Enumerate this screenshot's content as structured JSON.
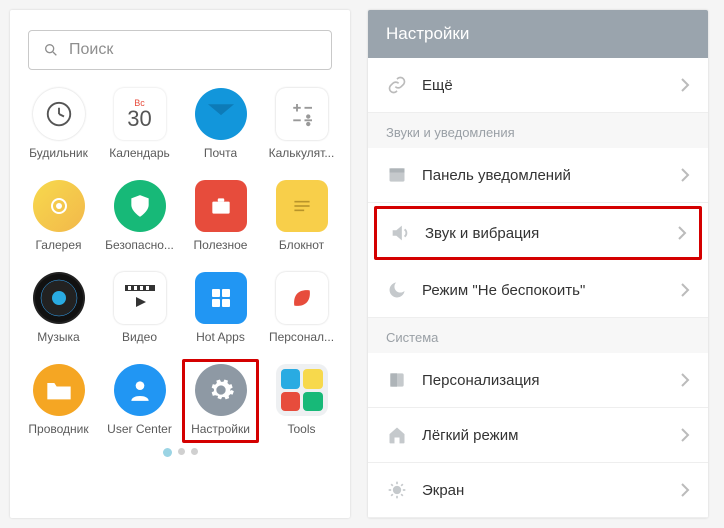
{
  "left": {
    "search_placeholder": "Поиск",
    "apps": [
      {
        "id": "alarm",
        "label": "Будильник"
      },
      {
        "id": "calendar",
        "label": "Календарь",
        "dow": "Вс",
        "day": "30"
      },
      {
        "id": "mail",
        "label": "Почта"
      },
      {
        "id": "calc",
        "label": "Калькулят..."
      },
      {
        "id": "gallery",
        "label": "Галерея"
      },
      {
        "id": "security",
        "label": "Безопасно..."
      },
      {
        "id": "useful",
        "label": "Полезное"
      },
      {
        "id": "notes",
        "label": "Блокнот"
      },
      {
        "id": "music",
        "label": "Музыка"
      },
      {
        "id": "video",
        "label": "Видео"
      },
      {
        "id": "hotapps",
        "label": "Hot Apps"
      },
      {
        "id": "personal",
        "label": "Персонал..."
      },
      {
        "id": "explorer",
        "label": "Проводник"
      },
      {
        "id": "usercenter",
        "label": "User Center"
      },
      {
        "id": "settings",
        "label": "Настройки",
        "highlight": true
      },
      {
        "id": "tools",
        "label": "Tools"
      }
    ]
  },
  "right": {
    "title": "Настройки",
    "rows": [
      {
        "type": "row",
        "icon": "link",
        "label": "Ещё"
      },
      {
        "type": "section",
        "label": "Звуки и уведомления"
      },
      {
        "type": "row",
        "icon": "panel",
        "label": "Панель уведомлений"
      },
      {
        "type": "row",
        "icon": "sound",
        "label": "Звук и вибрация",
        "highlight": true
      },
      {
        "type": "row",
        "icon": "moon",
        "label": "Режим \"Не беспокоить\""
      },
      {
        "type": "section",
        "label": "Система"
      },
      {
        "type": "row",
        "icon": "theme",
        "label": "Персонализация"
      },
      {
        "type": "row",
        "icon": "home",
        "label": "Лёгкий режим"
      },
      {
        "type": "row",
        "icon": "bright",
        "label": "Экран"
      }
    ]
  }
}
